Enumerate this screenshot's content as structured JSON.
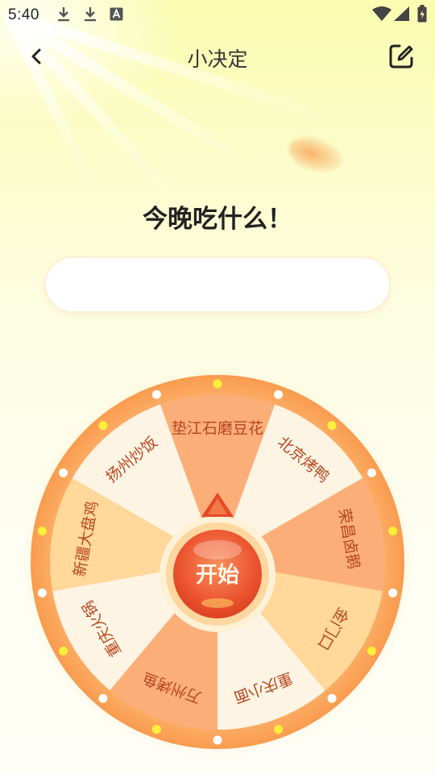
{
  "status_bar": {
    "time": "5:40",
    "left_icons": [
      "download-icon",
      "download-icon",
      "font-a-icon"
    ],
    "right_icons": [
      "wifi-icon",
      "signal-icon",
      "battery-icon"
    ]
  },
  "header": {
    "title": "小决定",
    "back_icon": "chevron-left-icon",
    "edit_icon": "edit-icon"
  },
  "question": "今晚吃什么！",
  "result_input": {
    "value": ""
  },
  "wheel": {
    "items": [
      "垫江石磨豆花",
      "北京烤鸭",
      "荣昌卤鹅",
      "金门口",
      "重庆小面",
      "万州烤鱼",
      "重庆火锅",
      "新疆大盘鸡",
      "扬州炒饭"
    ],
    "start_label": "开始",
    "colors": {
      "rim": "#fba35b",
      "segment_light": "#fdf4e4",
      "segment_orange": "#fcae78",
      "segment_peach": "#ffd89a",
      "segment_text": "#b6471f",
      "button": "#ee5630",
      "dot_yellow": "#ffef3a",
      "dot_white": "#ffffff"
    }
  }
}
